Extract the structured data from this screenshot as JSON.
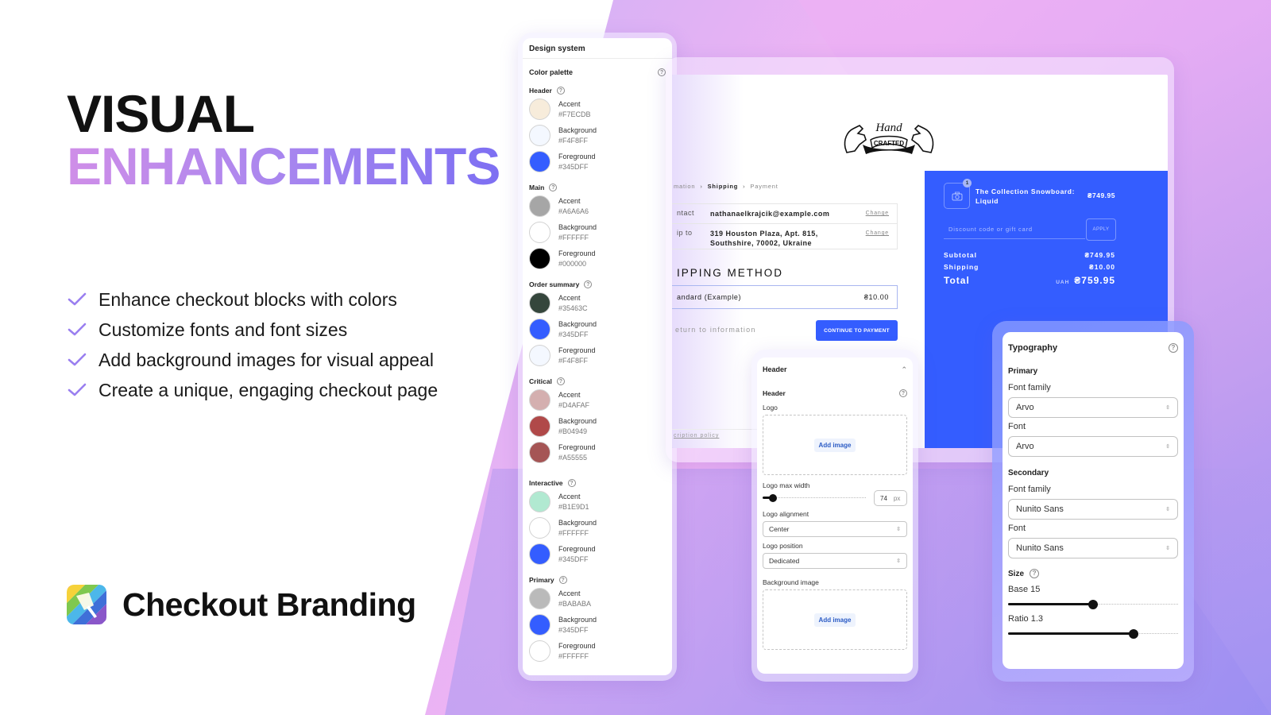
{
  "hero": {
    "title_line1": "VISUAL",
    "title_line2": "ENHANCEMENTS",
    "gradient_colors": [
      "#cf8ee8",
      "#a886ef",
      "#7d6ff2"
    ],
    "features": [
      "Enhance checkout blocks with colors",
      "Customize fonts and font sizes",
      "Add background images for visual appeal",
      "Create a unique, engaging checkout page"
    ],
    "check_icon": "checkmark-icon",
    "brand_name": "Checkout Branding",
    "brand_icon": "paintbrush-rainbow-icon"
  },
  "design_system": {
    "title": "Design system",
    "palette_title": "Color palette",
    "groups": [
      {
        "name": "Header",
        "swatches": [
          {
            "label": "Accent",
            "hex": "#F7ECDB"
          },
          {
            "label": "Background",
            "hex": "#F4F8FF"
          },
          {
            "label": "Foreground",
            "hex": "#345DFF"
          }
        ]
      },
      {
        "name": "Main",
        "swatches": [
          {
            "label": "Accent",
            "hex": "#A6A6A6"
          },
          {
            "label": "Background",
            "hex": "#FFFFFF"
          },
          {
            "label": "Foreground",
            "hex": "#000000"
          }
        ]
      },
      {
        "name": "Order summary",
        "swatches": [
          {
            "label": "Accent",
            "hex": "#35463C"
          },
          {
            "label": "Background",
            "hex": "#345DFF"
          },
          {
            "label": "Foreground",
            "hex": "#F4F8FF"
          }
        ]
      },
      {
        "name": "Critical",
        "swatches": [
          {
            "label": "Accent",
            "hex": "#D4AFAF"
          },
          {
            "label": "Background",
            "hex": "#B04949"
          },
          {
            "label": "Foreground",
            "hex": "#A55555"
          }
        ]
      },
      {
        "name": "Interactive",
        "swatches": [
          {
            "label": "Accent",
            "hex": "#B1E9D1"
          },
          {
            "label": "Background",
            "hex": "#FFFFFF"
          },
          {
            "label": "Foreground",
            "hex": "#345DFF"
          }
        ]
      },
      {
        "name": "Primary",
        "swatches": [
          {
            "label": "Accent",
            "hex": "#BABABA"
          },
          {
            "label": "Background",
            "hex": "#345DFF"
          },
          {
            "label": "Foreground",
            "hex": "#FFFFFF"
          }
        ]
      }
    ]
  },
  "checkout": {
    "logo_text_top": "Hand",
    "logo_text_ribbon": "CRAFTED",
    "breadcrumbs": [
      "mation",
      "Shipping",
      "Payment"
    ],
    "contact_label": "ntact",
    "contact_value": "nathanaelkrajcik@example.com",
    "shipto_label": "ip to",
    "shipto_value_line1": "319 Houston Plaza, Apt. 815,",
    "shipto_value_line2": "Southshire, 70002, Ukraine",
    "change_label": "Change",
    "shipping_method_title": "IPPING METHOD",
    "shipping_option": "andard (Example)",
    "shipping_option_price": "₴10.00",
    "return_link": "eturn to information",
    "continue_button": "CONTINUE TO PAYMENT",
    "policy_link": "cription policy",
    "summary": {
      "background": "#345DFF",
      "quantity_badge": "1",
      "product_name": "The Collection Snowboard: Liquid",
      "product_price": "₴749.95",
      "discount_placeholder": "Discount code or gift card",
      "apply_button": "APPLY",
      "subtotal_label": "Subtotal",
      "subtotal_value": "₴749.95",
      "shipping_label": "Shipping",
      "shipping_value": "₴10.00",
      "total_label": "Total",
      "total_currency": "UAH",
      "total_value": "₴759.95"
    }
  },
  "header_settings": {
    "title": "Header",
    "section_title": "Header",
    "logo_label": "Logo",
    "add_image_label": "Add image",
    "logo_max_width_label": "Logo max width",
    "logo_max_width_value": "74",
    "logo_max_width_unit": "px",
    "logo_max_width_fraction": 0.1,
    "logo_alignment_label": "Logo alignment",
    "logo_alignment_value": "Center",
    "logo_position_label": "Logo position",
    "logo_position_value": "Dedicated",
    "background_image_label": "Background image",
    "background_add_image_label": "Add image"
  },
  "typography": {
    "title": "Typography",
    "primary_title": "Primary",
    "primary_font_family_label": "Font family",
    "primary_font_family_value": "Arvo",
    "primary_font_label": "Font",
    "primary_font_value": "Arvo",
    "secondary_title": "Secondary",
    "secondary_font_family_label": "Font family",
    "secondary_font_family_value": "Nunito Sans",
    "secondary_font_label": "Font",
    "secondary_font_value": "Nunito Sans",
    "size_title": "Size",
    "base_label": "Base 15",
    "base_fraction": 0.5,
    "ratio_label": "Ratio 1.3",
    "ratio_fraction": 0.74
  }
}
